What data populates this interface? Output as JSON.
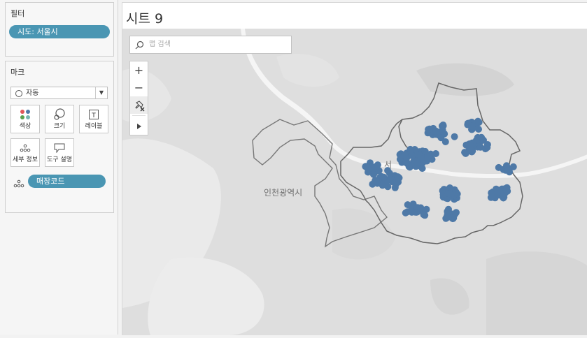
{
  "filters_card": {
    "title": "필터",
    "pill": "시도: 서울시"
  },
  "marks_card": {
    "title": "마크",
    "mark_type": "자동",
    "buttons": {
      "color": "색상",
      "size": "크기",
      "label": "레이블",
      "detail": "세부 정보",
      "tooltip": "도구 설명"
    },
    "detail_field": "매장코드"
  },
  "sheet": {
    "title": "시트 9"
  },
  "map": {
    "search_placeholder": "맵 검색",
    "city_label": "인천광역시",
    "seoul_label_fragment": "서",
    "colors": {
      "mark": "#4e79a7",
      "pill": "#4a96b3",
      "background": "#dedede"
    },
    "icons": [
      "search-icon",
      "zoom-in-icon",
      "zoom-out-icon",
      "pin-reset-icon",
      "expand-arrow-icon"
    ]
  }
}
